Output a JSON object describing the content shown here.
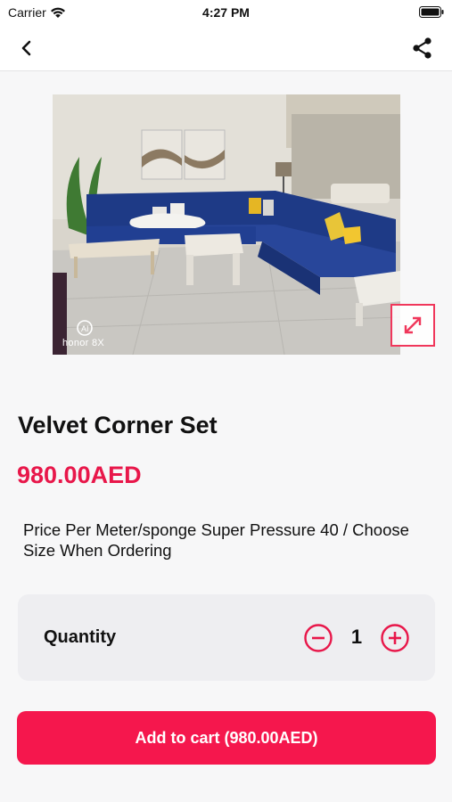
{
  "status_bar": {
    "carrier": "Carrier",
    "time": "4:27 PM"
  },
  "nav": {
    "back_icon": "chevron-left-icon",
    "share_icon": "share-icon"
  },
  "product": {
    "image_watermark": "honor 8X",
    "title": "Velvet Corner Set",
    "price": "980.00AED",
    "description": "Price Per Meter/sponge Super Pressure 40 / Choose Size When Ordering"
  },
  "quantity": {
    "label": "Quantity",
    "value": "1"
  },
  "cart_button": {
    "label": "Add to cart (980.00AED)"
  },
  "colors": {
    "accent": "#f5174d",
    "price": "#e8174a",
    "card_bg": "#eeeef1",
    "page_bg": "#f7f7f8"
  }
}
